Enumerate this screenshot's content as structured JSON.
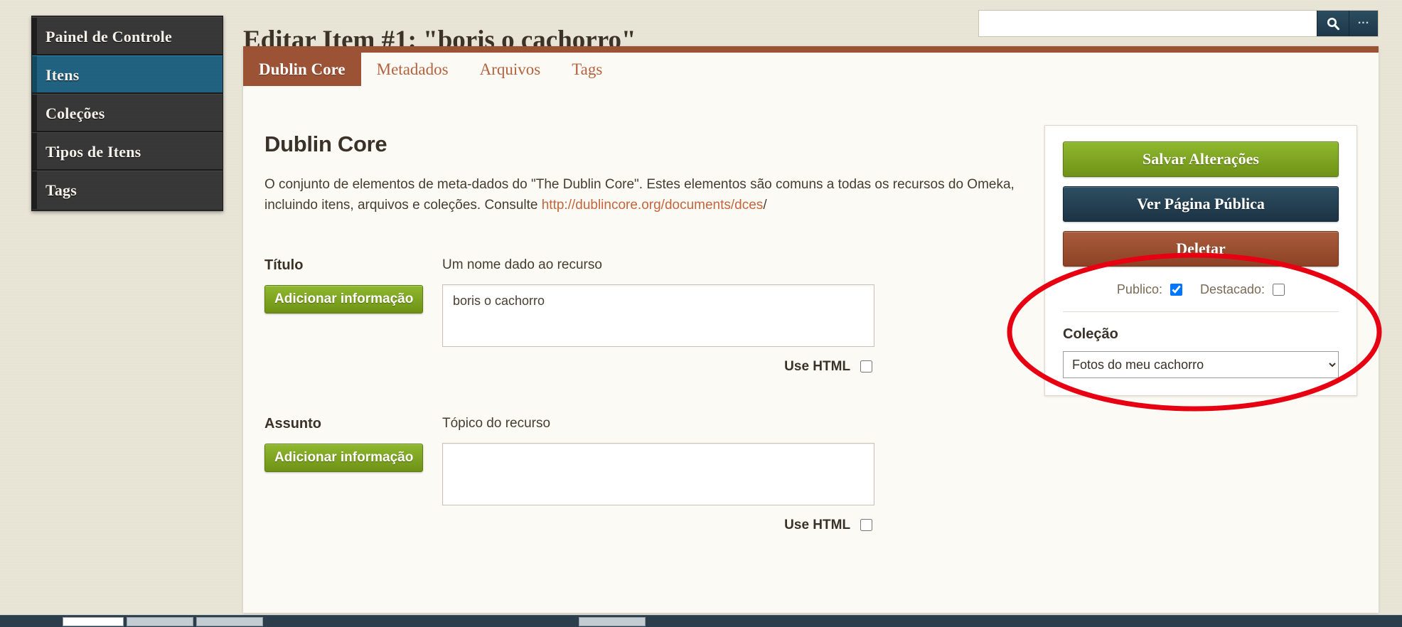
{
  "app": {
    "page_title": "Editar Item #1: \"boris o cachorro\"",
    "accent_brown": "#9c5235",
    "accent_green": "#7da41e",
    "accent_blue": "#1f6383",
    "annotation_color": "#e60012"
  },
  "search": {
    "value": "",
    "placeholder": "",
    "submit_icon": "search-icon",
    "advanced_label": "..."
  },
  "sidebar": {
    "items": [
      {
        "label": "Painel de Controle",
        "active": false
      },
      {
        "label": "Itens",
        "active": true
      },
      {
        "label": "Coleções",
        "active": false
      },
      {
        "label": "Tipos de Itens",
        "active": false
      },
      {
        "label": "Tags",
        "active": false
      }
    ]
  },
  "tabs": [
    {
      "label": "Dublin Core",
      "active": true
    },
    {
      "label": "Metadados",
      "active": false
    },
    {
      "label": "Arquivos",
      "active": false
    },
    {
      "label": "Tags",
      "active": false
    }
  ],
  "main": {
    "section_title": "Dublin Core",
    "description_part1": "O conjunto de elementos de meta-dados do \"The Dublin Core\". Estes elementos são comuns a todas os recursos do Omeka, incluindo itens, arquivos e coleções. Consulte ",
    "description_link": "http://dublincore.org/documents/dces",
    "description_part2": "/",
    "fields": [
      {
        "label": "Título",
        "add_button": "Adicionar informação",
        "hint": "Um nome dado ao recurso",
        "value": "boris o cachorro",
        "use_html_label": "Use HTML",
        "use_html_checked": false
      },
      {
        "label": "Assunto",
        "add_button": "Adicionar informação",
        "hint": "Tópico do recurso",
        "value": "",
        "use_html_label": "Use HTML",
        "use_html_checked": false
      }
    ]
  },
  "actions": {
    "save_label": "Salvar Alterações",
    "view_public_label": "Ver Página Pública",
    "delete_label": "Deletar",
    "public_label": "Publico:",
    "public_checked": true,
    "featured_label": "Destacado:",
    "featured_checked": false,
    "collection_label": "Coleção",
    "collection_selected": "Fotos do meu cachorro",
    "collection_options": [
      "Fotos do meu cachorro"
    ]
  }
}
